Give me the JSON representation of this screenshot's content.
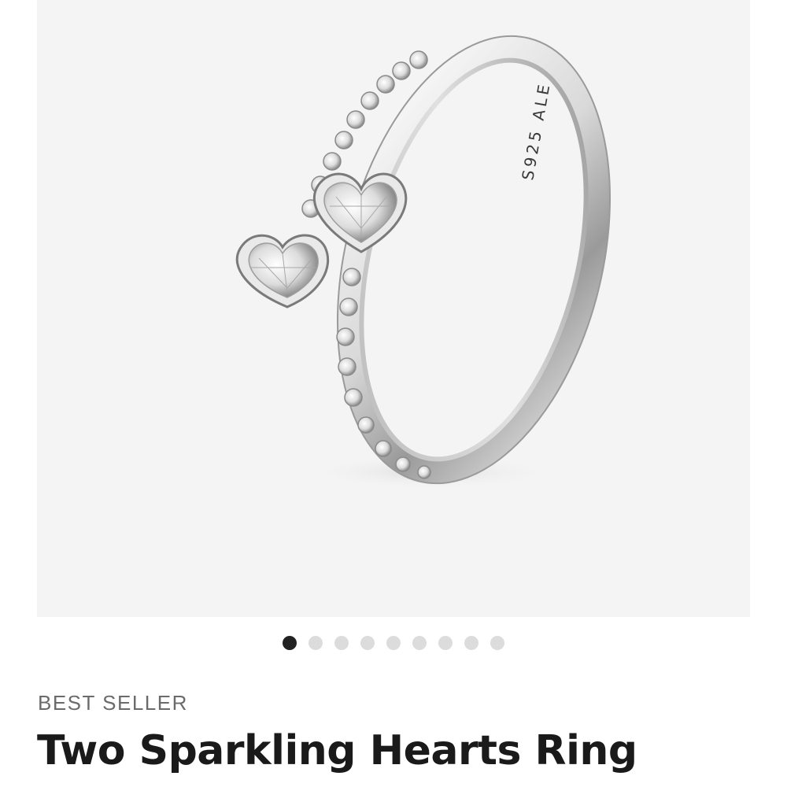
{
  "product": {
    "badge": "BEST SELLER",
    "title": "Two Sparkling Hearts Ring",
    "engraving": "S925 ALE"
  },
  "gallery": {
    "image_count": 9,
    "active_index": 0,
    "next_icon": "chevron-right-icon"
  },
  "colors": {
    "background": "#f4f4f4",
    "active_dot": "#222222",
    "inactive_dot": "#dcdcdc",
    "title": "#1a1a1a",
    "badge": "#6b6b6b"
  }
}
